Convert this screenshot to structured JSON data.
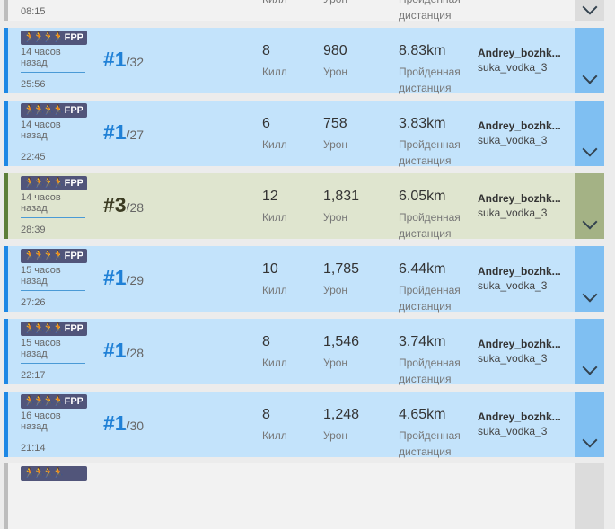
{
  "labels": {
    "kills": "Килл",
    "damage": "Урон",
    "distance": "Пройденная дистанция",
    "mode": "FPP",
    "players_icon": "🏃🏃🏃🏃"
  },
  "top_partial": {
    "duration": "08:15"
  },
  "matches": [
    {
      "ago": "14 часов назад",
      "duration": "25:56",
      "place": "#1",
      "total": "/32",
      "kills": "8",
      "damage": "980",
      "distance": "8.83km",
      "player": "Andrey_bozhk...",
      "team": "suka_vodka_3"
    },
    {
      "ago": "14 часов назад",
      "duration": "22:45",
      "place": "#1",
      "total": "/27",
      "kills": "6",
      "damage": "758",
      "distance": "3.83km",
      "player": "Andrey_bozhk...",
      "team": "suka_vodka_3"
    },
    {
      "ago": "14 часов назад",
      "duration": "28:39",
      "place": "#3",
      "total": "/28",
      "kills": "12",
      "damage": "1,831",
      "distance": "6.05km",
      "player": "Andrey_bozhk...",
      "team": "suka_vodka_3"
    },
    {
      "ago": "15 часов назад",
      "duration": "27:26",
      "place": "#1",
      "total": "/29",
      "kills": "10",
      "damage": "1,785",
      "distance": "6.44km",
      "player": "Andrey_bozhk...",
      "team": "suka_vodka_3"
    },
    {
      "ago": "15 часов назад",
      "duration": "22:17",
      "place": "#1",
      "total": "/28",
      "kills": "8",
      "damage": "1,546",
      "distance": "3.74km",
      "player": "Andrey_bozhk...",
      "team": "suka_vodka_3"
    },
    {
      "ago": "16 часов назад",
      "duration": "21:14",
      "place": "#1",
      "total": "/30",
      "kills": "8",
      "damage": "1,248",
      "distance": "4.65km",
      "player": "Andrey_bozhk...",
      "team": "suka_vodka_3"
    }
  ],
  "colors": {
    "win_row": "#c3e3fb",
    "third_row": "#dfe5cf",
    "accent_blue": "#1e88e5",
    "badge": "#51557a"
  }
}
